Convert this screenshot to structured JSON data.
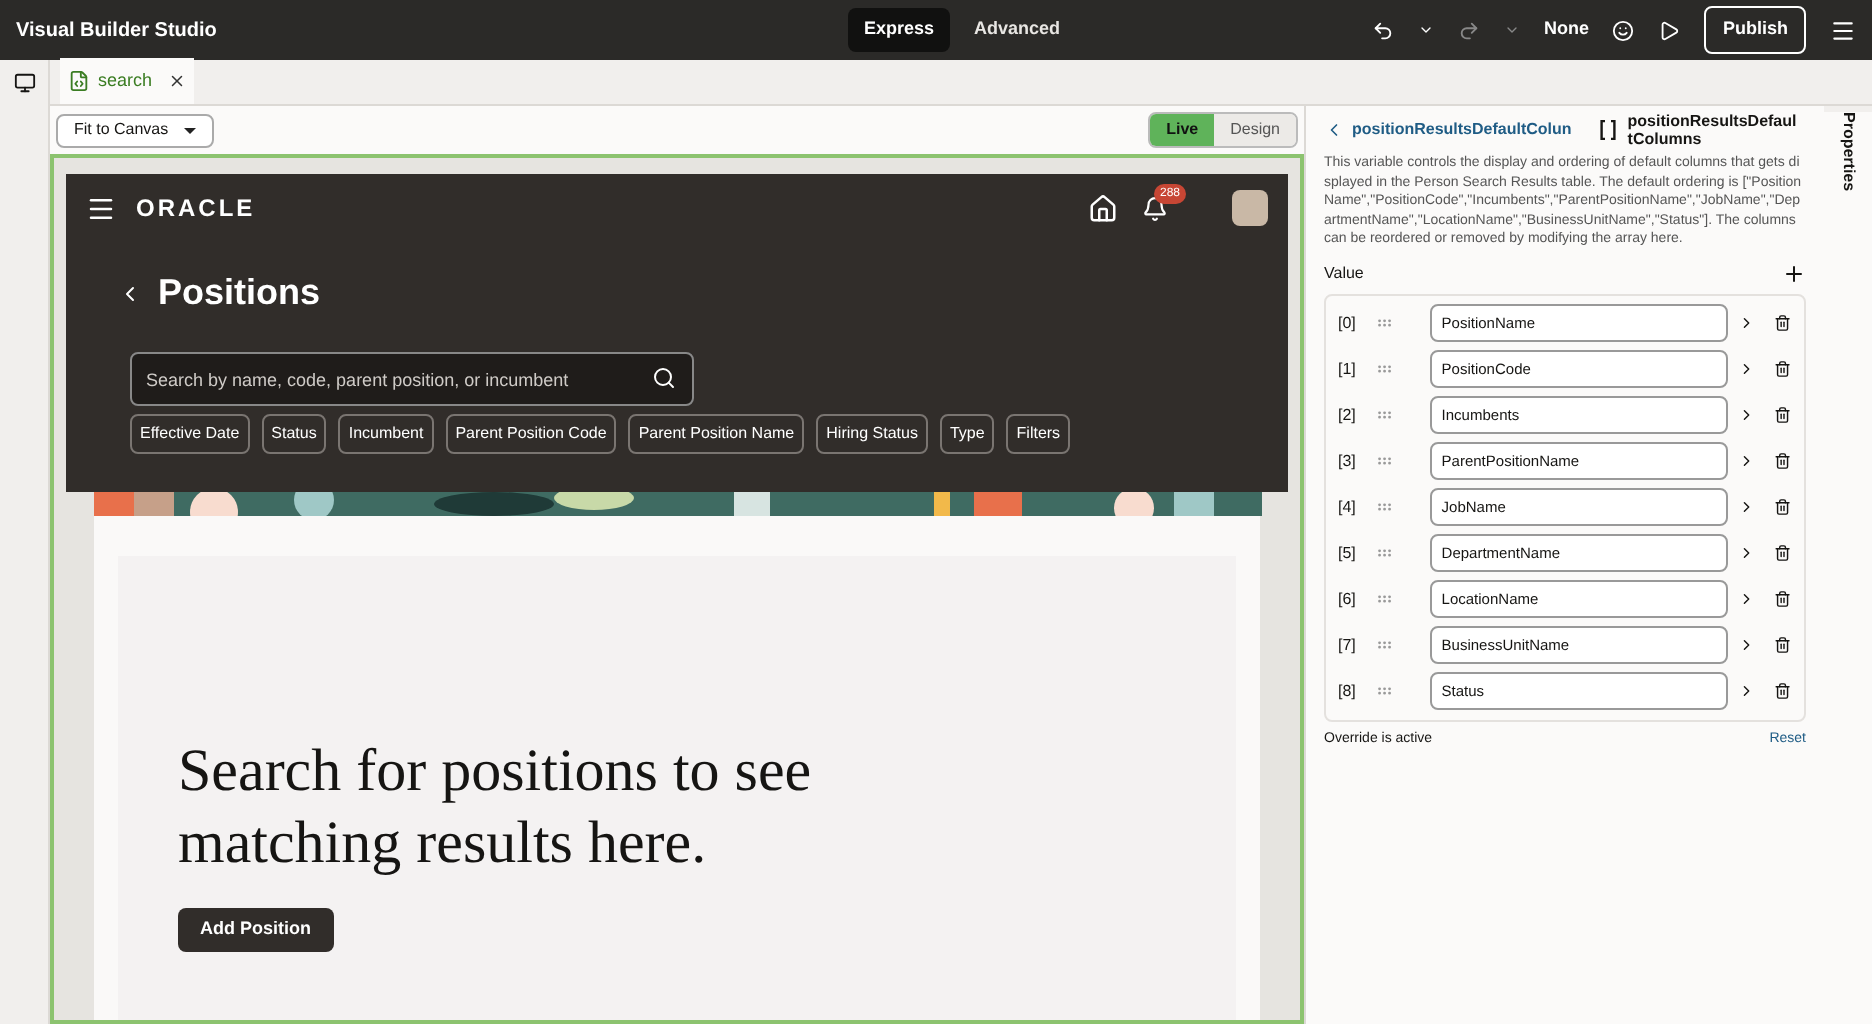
{
  "app": {
    "title": "Visual Builder Studio",
    "modes": [
      {
        "label": "Express",
        "selected": true
      },
      {
        "label": "Advanced",
        "selected": false
      }
    ],
    "version_label": "None",
    "publish": "Publish"
  },
  "tabs": [
    {
      "label": "search",
      "selected": true
    }
  ],
  "canvas_toolbar": {
    "zoom": "Fit to Canvas",
    "view_modes": [
      {
        "label": "Live",
        "selected": true
      },
      {
        "label": "Design",
        "selected": false
      }
    ]
  },
  "preview": {
    "brand": "ORACLE",
    "notification_count": "288",
    "title": "Positions",
    "search_placeholder": "Search by name, code, parent position, or incumbent",
    "filters": [
      "Effective Date",
      "Status",
      "Incumbent",
      "Parent Position Code",
      "Parent Position Name",
      "Hiring Status",
      "Type",
      "Filters"
    ],
    "empty_message": "Search for positions to see matching results here.",
    "add_button": "Add Position"
  },
  "properties": {
    "breadcrumb": "positionResultsDefaultColun",
    "variable_name": "positionResultsDefaultColumns",
    "description": "This variable controls the display and ordering of default columns that gets displayed in the Person Search Results table. The default ordering is [\"PositionName\",\"PositionCode\",\"Incumbents\",\"ParentPositionName\",\"JobName\",\"DepartmentName\",\"LocationName\",\"BusinessUnitName\",\"Status\"]. The columns can be reordered or removed by modifying the array here.",
    "value_label": "Value",
    "items": [
      {
        "index": "[0]",
        "value": "PositionName"
      },
      {
        "index": "[1]",
        "value": "PositionCode"
      },
      {
        "index": "[2]",
        "value": "Incumbents"
      },
      {
        "index": "[3]",
        "value": "ParentPositionName"
      },
      {
        "index": "[4]",
        "value": "JobName"
      },
      {
        "index": "[5]",
        "value": "DepartmentName"
      },
      {
        "index": "[6]",
        "value": "LocationName"
      },
      {
        "index": "[7]",
        "value": "BusinessUnitName"
      },
      {
        "index": "[8]",
        "value": "Status"
      }
    ],
    "override": "Override is active",
    "reset": "Reset"
  },
  "side_tab": "Properties"
}
